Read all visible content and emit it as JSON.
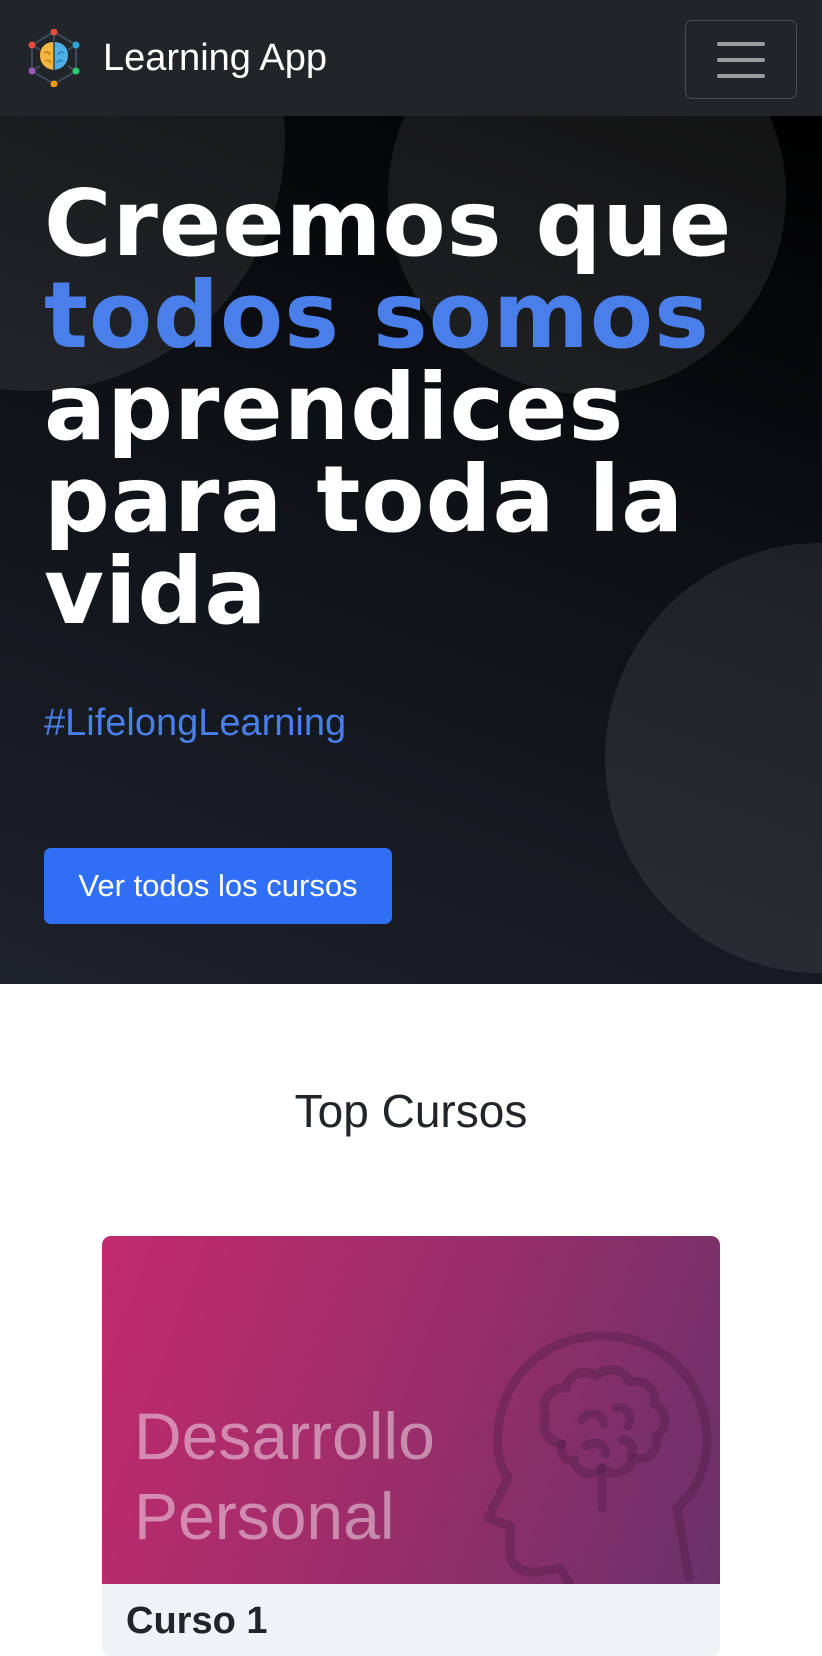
{
  "navbar": {
    "brand_name": "Learning App",
    "logo_icon": "brain-network-icon",
    "menu_icon": "hamburger-menu-icon"
  },
  "hero": {
    "title_line1": "Creemos que",
    "title_accent": "todos somos",
    "title_line3": "aprendices",
    "title_line4": "para toda la",
    "title_line5": "vida",
    "hashtag": "#LifelongLearning",
    "cta_label": "Ver todos los cursos"
  },
  "top_courses": {
    "heading": "Top Cursos",
    "courses": [
      {
        "category": "Desarrollo Personal",
        "category_line1": "Desarrollo",
        "category_line2": "Personal",
        "icon": "head-brain-icon",
        "title": "Curso 1"
      }
    ]
  },
  "colors": {
    "navbar_bg": "#212529",
    "accent_blue": "#4a7ee8",
    "button_blue": "#2f6ff6",
    "card_gradient_start": "#c22a6e",
    "card_gradient_end": "#6a3169"
  }
}
